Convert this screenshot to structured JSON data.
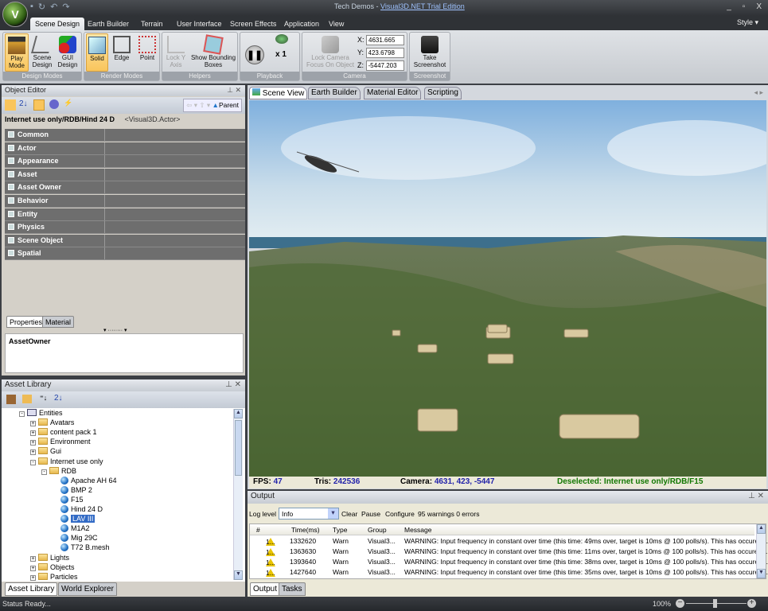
{
  "app": {
    "title_prefix": "Tech Demos - ",
    "title_link": "Visual3D.NET  Trial  Edition",
    "window_controls": [
      "_",
      "▫",
      "X"
    ]
  },
  "ribbon_tabs": [
    "Scene Design",
    "Earth Builder",
    "Terrain",
    "User Interface",
    "Screen Effects",
    "Application",
    "View"
  ],
  "style_menu": "Style ▾",
  "ribbon": {
    "design_modes": {
      "label": "Design Modes",
      "play": "Play Mode",
      "scene": "Scene Design",
      "gui": "GUI Design"
    },
    "render_modes": {
      "label": "Render Modes",
      "solid": "Solid",
      "edge": "Edge",
      "point": "Point"
    },
    "helpers": {
      "label": "Helpers",
      "lock_y": "Lock Y Axis",
      "bounding": "Show Bounding Boxes"
    },
    "playback": {
      "label": "Playback",
      "speed": "x 1"
    },
    "camera": {
      "label": "Camera",
      "lock": "Lock Camera Focus On Object",
      "x_label": "X:",
      "y_label": "Y:",
      "z_label": "Z:",
      "x": "4631.665",
      "y": "423.6798",
      "z": "-5447.203"
    },
    "screenshot": {
      "label": "Screenshot",
      "take": "Take Screenshot"
    }
  },
  "object_editor": {
    "title": "Object Editor",
    "parent": "Parent",
    "object_path": "Internet use only/RDB/Hind 24 D",
    "object_type": "<Visual3D.Actor>",
    "categories": [
      "Common",
      "Actor",
      "Appearance",
      "Asset",
      "Asset Owner",
      "Behavior",
      "Entity",
      "Physics",
      "Scene Object",
      "Spatial"
    ],
    "tabs": [
      "Properties",
      "Material"
    ],
    "description_title": "AssetOwner"
  },
  "asset_library": {
    "title": "Asset Library",
    "tree": [
      {
        "label": "Entities",
        "depth": 0,
        "icon": "entities",
        "toggle": "-"
      },
      {
        "label": "Avatars",
        "depth": 1,
        "icon": "folder",
        "toggle": "+"
      },
      {
        "label": "content pack 1",
        "depth": 1,
        "icon": "folder",
        "toggle": "+"
      },
      {
        "label": "Environment",
        "depth": 1,
        "icon": "folder",
        "toggle": "+"
      },
      {
        "label": "Gui",
        "depth": 1,
        "icon": "folder",
        "toggle": "+"
      },
      {
        "label": "Internet use only",
        "depth": 1,
        "icon": "folder-open",
        "toggle": "-"
      },
      {
        "label": "RDB",
        "depth": 2,
        "icon": "folder-open",
        "toggle": "-"
      },
      {
        "label": "Apache AH 64",
        "depth": 3,
        "icon": "asset"
      },
      {
        "label": "BMP 2",
        "depth": 3,
        "icon": "asset"
      },
      {
        "label": "F15",
        "depth": 3,
        "icon": "asset"
      },
      {
        "label": "Hind 24 D",
        "depth": 3,
        "icon": "asset"
      },
      {
        "label": "LAV III",
        "depth": 3,
        "icon": "asset",
        "selected": true
      },
      {
        "label": "M1A2",
        "depth": 3,
        "icon": "asset"
      },
      {
        "label": "Mig 29C",
        "depth": 3,
        "icon": "asset"
      },
      {
        "label": "T72 B.mesh",
        "depth": 3,
        "icon": "asset"
      },
      {
        "label": "Lights",
        "depth": 1,
        "icon": "folder",
        "toggle": "+"
      },
      {
        "label": "Objects",
        "depth": 1,
        "icon": "folder",
        "toggle": "+"
      },
      {
        "label": "Particles",
        "depth": 1,
        "icon": "folder",
        "toggle": "+"
      }
    ],
    "tabs": [
      "Asset Library",
      "World Explorer"
    ]
  },
  "view_tabs": [
    "Scene View",
    "Earth Builder",
    "Material Editor",
    "Scripting"
  ],
  "scene_status": {
    "fps_label": "FPS:",
    "fps": "47",
    "tris_label": "Tris:",
    "tris": "242536",
    "camera_label": "Camera:",
    "camera": "4631, 423, -5447",
    "selection": "Deselected: Internet use only/RDB/F15"
  },
  "output": {
    "title": "Output",
    "log_level_label": "Log level",
    "log_level": "Info",
    "clear": "Clear",
    "pause": "Pause",
    "configure": "Configure",
    "summary": "95 warnings 0 errors",
    "columns": [
      "#",
      "Time(ms)",
      "Type",
      "Group",
      "Message"
    ],
    "rows": [
      {
        "num": "1...",
        "time": "1332620",
        "type": "Warn",
        "group": "Visual3...",
        "message": "WARNING: Input frequency in constant over time (this time: 49ms over, target is 10ms @ 100 polls/s). This has occured ..."
      },
      {
        "num": "1...",
        "time": "1363630",
        "type": "Warn",
        "group": "Visual3...",
        "message": "WARNING: Input frequency in constant over time (this time: 11ms over, target is 10ms @ 100 polls/s). This has occured ..."
      },
      {
        "num": "1...",
        "time": "1393640",
        "type": "Warn",
        "group": "Visual3...",
        "message": "WARNING: Input frequency in constant over time (this time: 38ms over, target is 10ms @ 100 polls/s). This has occured ..."
      },
      {
        "num": "1...",
        "time": "1427640",
        "type": "Warn",
        "group": "Visual3...",
        "message": "WARNING: Input frequency in constant over time (this time: 35ms over, target is 10ms @ 100 polls/s). This has occured ..."
      }
    ],
    "tabs": [
      "Output",
      "Tasks"
    ]
  },
  "statusbar": {
    "text": "Status Ready...",
    "zoom": "100%",
    "zoom_level_percent": 100
  }
}
